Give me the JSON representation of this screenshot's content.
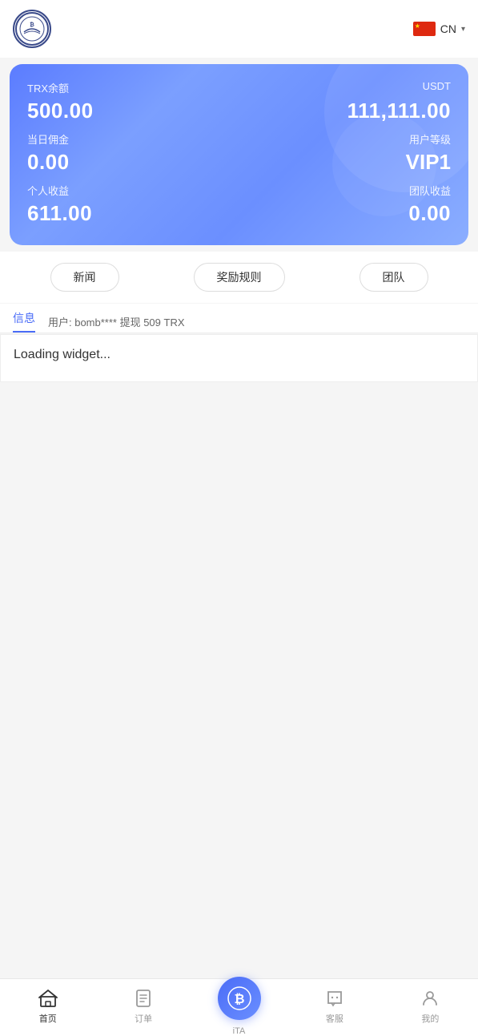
{
  "header": {
    "logo_alt": "BTC Logo",
    "lang_code": "CN",
    "lang_icon": "flag-cn"
  },
  "dashboard": {
    "trx_label": "TRX余额",
    "usdt_label": "USDT",
    "trx_value": "500.00",
    "usdt_value": "111,111.00",
    "commission_label": "当日佣金",
    "user_level_label": "用户等级",
    "commission_value": "0.00",
    "user_level_value": "VIP1",
    "personal_income_label": "个人收益",
    "team_income_label": "团队收益",
    "personal_income_value": "611.00",
    "team_income_value": "0.00"
  },
  "quick_buttons": [
    {
      "label": "新闻",
      "id": "news"
    },
    {
      "label": "奖励规则",
      "id": "rules"
    },
    {
      "label": "团队",
      "id": "team"
    }
  ],
  "info": {
    "tab_label": "信息",
    "ticker_text": "用户: bomb**** 提现 509 TRX"
  },
  "widget": {
    "loading_text": "Loading widget..."
  },
  "bottom_nav": [
    {
      "label": "首页",
      "icon": "home",
      "active": true
    },
    {
      "label": "订单",
      "icon": "order",
      "active": false
    },
    {
      "label": "iTA",
      "icon": "btc-center",
      "active": false,
      "is_center": true
    },
    {
      "label": "客服",
      "icon": "chat",
      "active": false
    },
    {
      "label": "我的",
      "icon": "profile",
      "active": false
    }
  ]
}
